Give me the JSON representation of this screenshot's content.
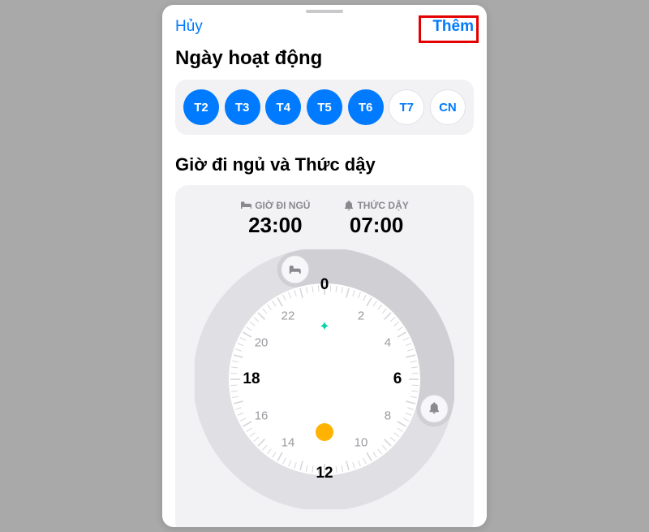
{
  "nav": {
    "cancel": "Hủy",
    "add": "Thêm"
  },
  "section_days": {
    "title": "Ngày hoạt động",
    "days": [
      {
        "label": "T2",
        "active": true
      },
      {
        "label": "T3",
        "active": true
      },
      {
        "label": "T4",
        "active": true
      },
      {
        "label": "T5",
        "active": true
      },
      {
        "label": "T6",
        "active": true
      },
      {
        "label": "T7",
        "active": false
      },
      {
        "label": "CN",
        "active": false
      }
    ]
  },
  "section_clock": {
    "title": "Giờ đi ngủ và Thức dậy",
    "bedtime_label": "GIỜ ĐI NGỦ",
    "bedtime_value": "23:00",
    "wake_label": "THỨC DẬY",
    "wake_value": "07:00",
    "hours": [
      "0",
      "2",
      "4",
      "6",
      "8",
      "10",
      "12",
      "14",
      "16",
      "18",
      "20",
      "22"
    ],
    "major_hours": [
      "0",
      "6",
      "12",
      "18"
    ]
  },
  "icons": {
    "bed": "bed-icon",
    "bell": "bell-icon",
    "sparkle": "sparkle-icon",
    "sun": "sun-icon"
  },
  "colors": {
    "accent": "#007aff",
    "highlight_box": "#e50000",
    "muted": "#8a8a8e"
  }
}
